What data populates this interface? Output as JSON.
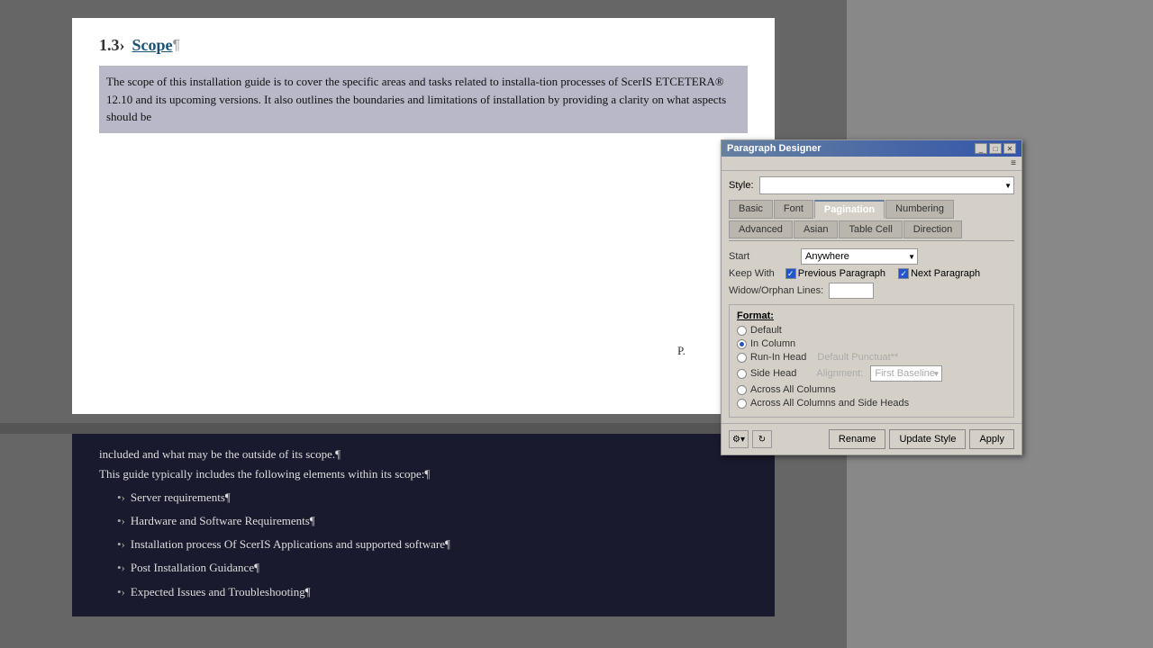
{
  "document": {
    "section_number": "1.3›",
    "section_title": "Scope",
    "para_mark": "¶",
    "body_text": "The scope of this installation guide is to cover the specific areas and tasks related to installa-tion processes of ScerIS ETCETERA® 12.10 and its upcoming versions. It also outlines the boundaries and limitations of installation by providing a clarity on what aspects should be",
    "bottom_intro": "included and what may be the outside of its scope.¶",
    "guide_intro": "This guide typically includes the following elements within its scope:¶",
    "bullets": [
      "Server requirements¶",
      "Hardware and Software Requirements¶",
      "Installation process Of ScerIS Applications and supported software¶",
      "Post Installation Guidance¶",
      "Expected Issues and Troubleshooting¶"
    ],
    "page_label": "P."
  },
  "dialog": {
    "title": "Paragraph Designer",
    "menu_icon": "≡",
    "style_label": "Style:",
    "style_value": "",
    "tabs": [
      "Basic",
      "Font",
      "Pagination",
      "Numbering",
      "Advanced",
      "Asian",
      "Table Cell",
      "Direction"
    ],
    "active_tab": "Pagination",
    "start_label": "Start",
    "start_value": "Anywhere",
    "keep_with_label": "Keep With",
    "prev_paragraph": "Previous Paragraph",
    "next_paragraph": "Next Paragraph",
    "widow_label": "Widow/Orphan Lines:",
    "widow_value": "",
    "format_label": "Format:",
    "format_options": [
      {
        "label": "Default",
        "selected": false
      },
      {
        "label": "In Column",
        "selected": true
      },
      {
        "label": "Run-In Head",
        "selected": false
      },
      {
        "label": "Side Head",
        "selected": false
      },
      {
        "label": "Across All Columns",
        "selected": false
      },
      {
        "label": "Across All Columns and Side Heads",
        "selected": false
      }
    ],
    "default_punctuat": "Default Punctuat**",
    "alignment_label": "Alignment:",
    "first_baseline": "First Baseline",
    "rename_btn": "Rename",
    "update_btn": "Update Style",
    "apply_btn": "Apply",
    "gear_icon": "⚙",
    "refresh_icon": "↻"
  }
}
